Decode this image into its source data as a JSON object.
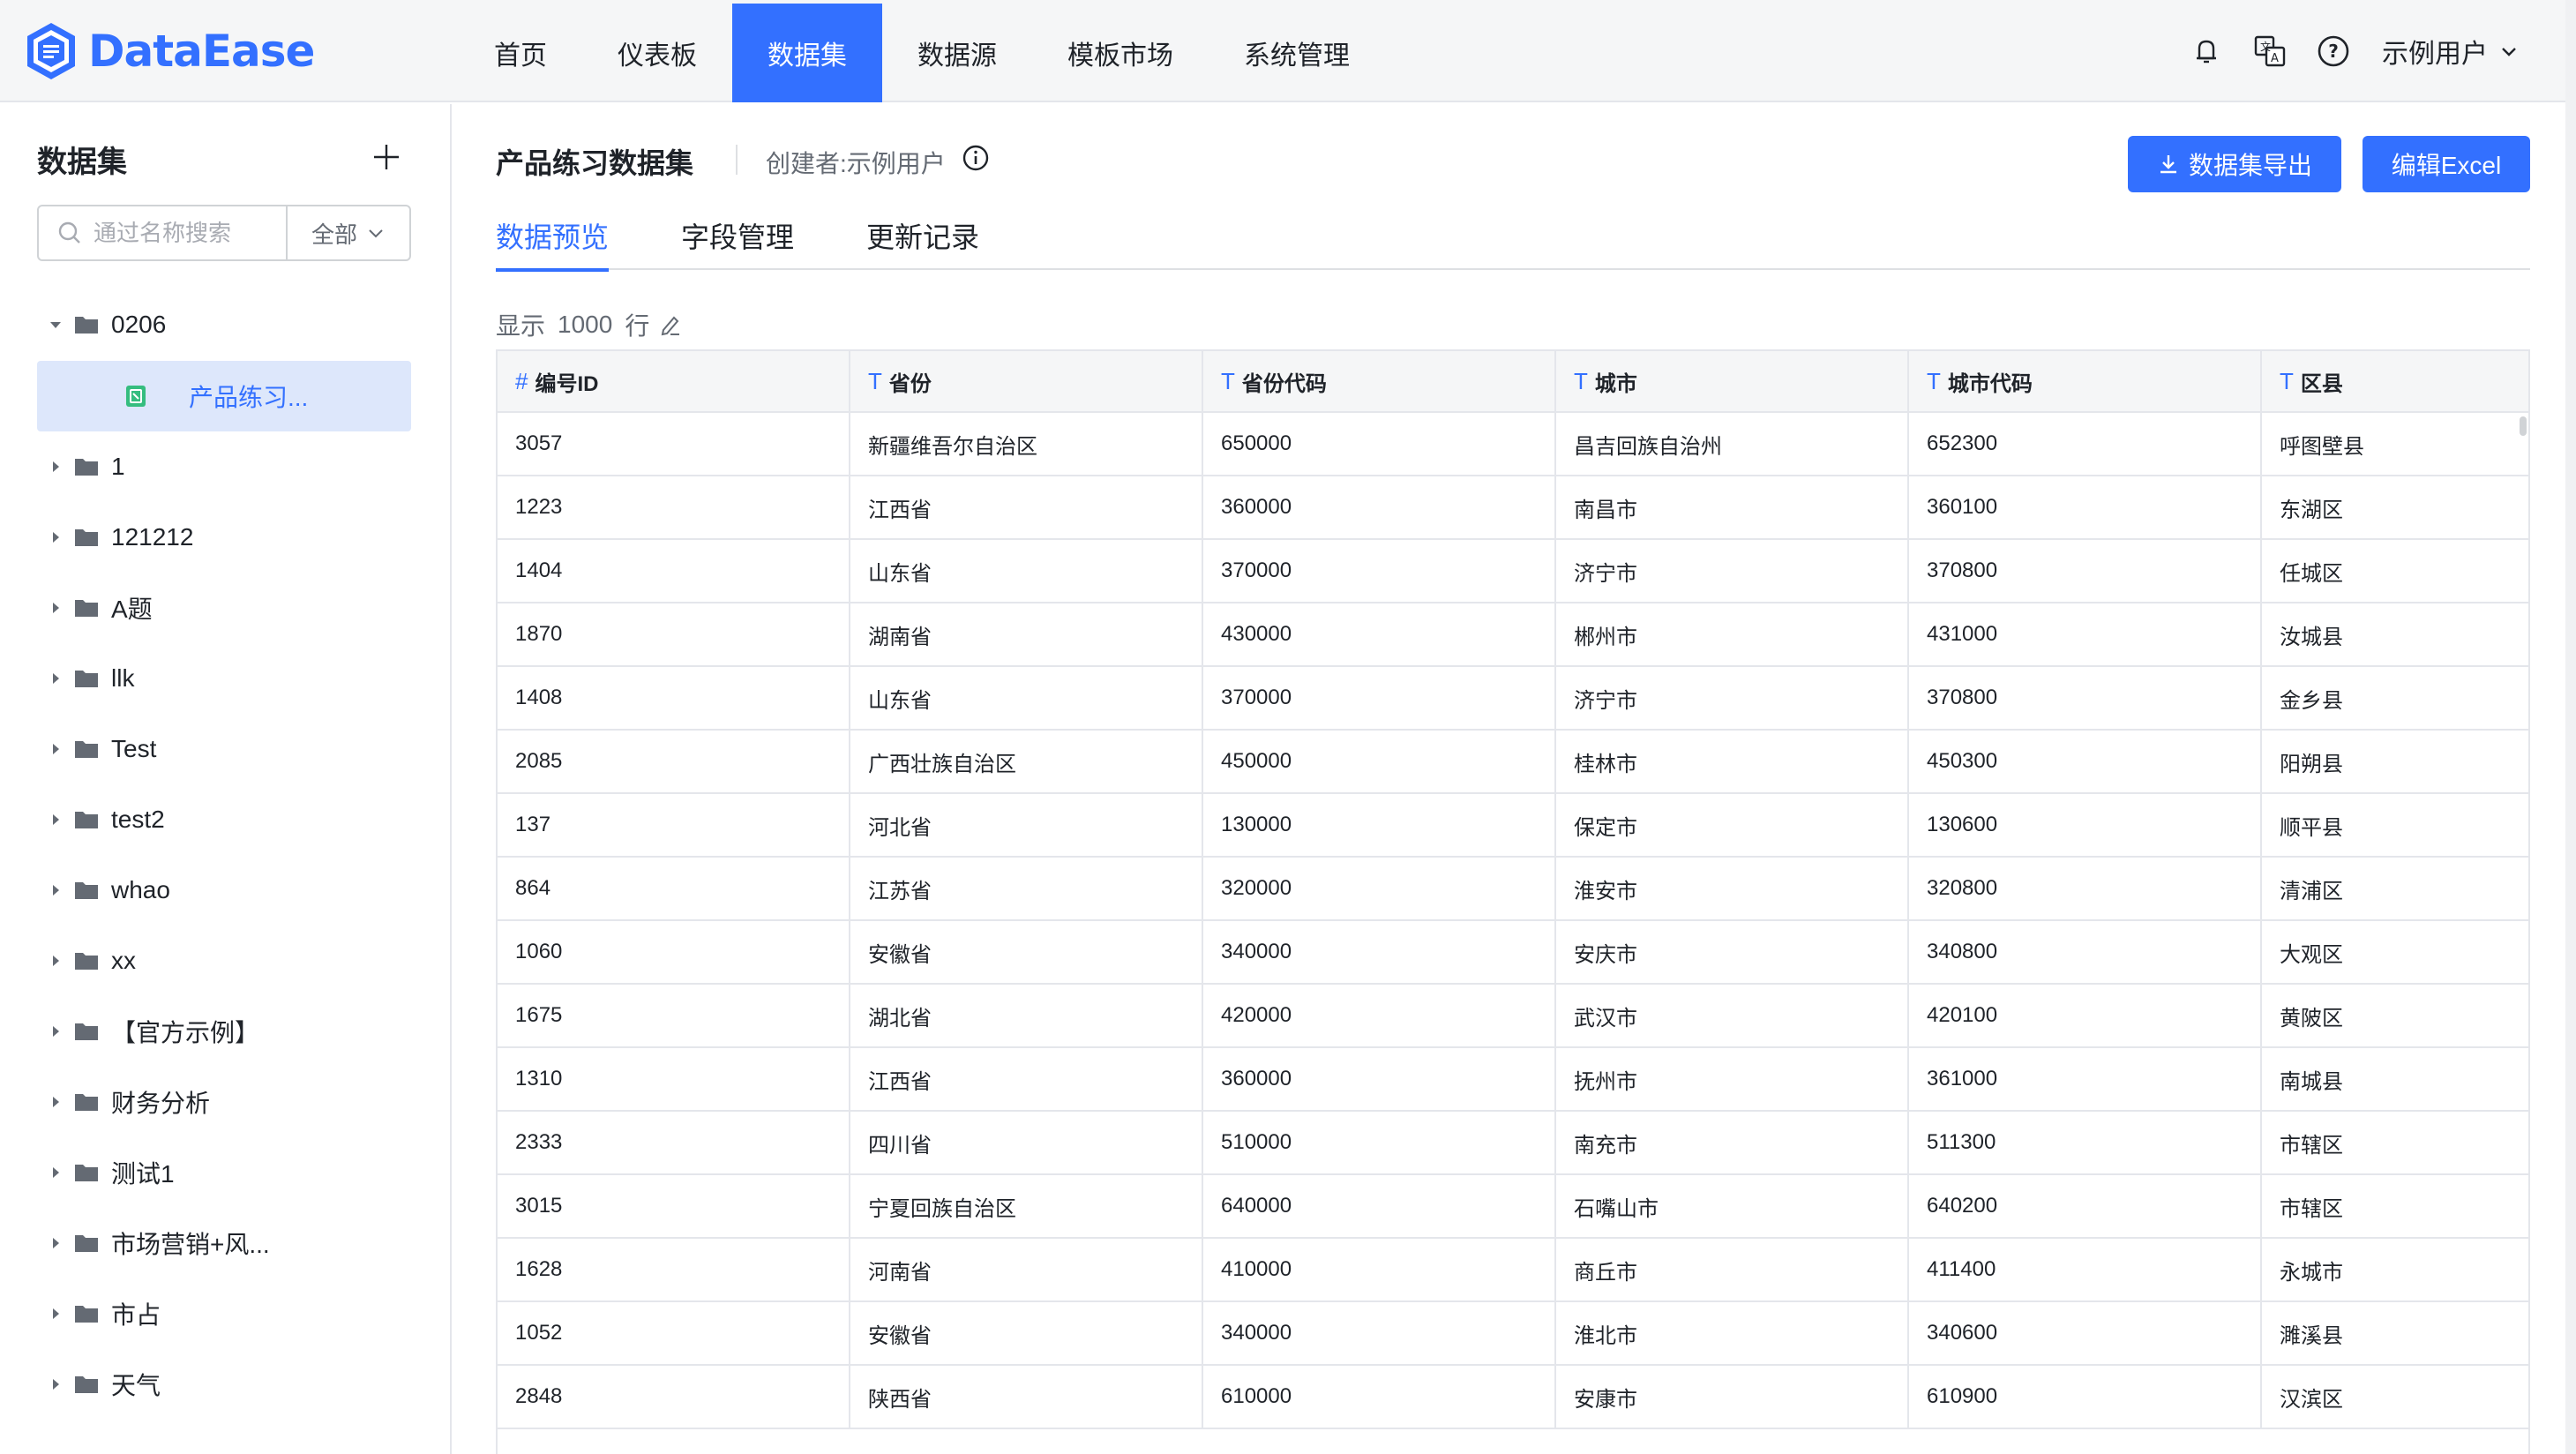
{
  "app": {
    "name": "DataEase",
    "brand_color": "#3370ff"
  },
  "nav": {
    "items": [
      "首页",
      "仪表板",
      "数据集",
      "数据源",
      "模板市场",
      "系统管理"
    ],
    "active_index": 2
  },
  "top_right": {
    "icons": [
      "notification-bell-icon",
      "translate-icon",
      "help-icon"
    ],
    "user_name": "示例用户"
  },
  "sidebar": {
    "title": "数据集",
    "search_placeholder": "通过名称搜索",
    "filter_label": "全部",
    "tree": [
      {
        "label": "0206",
        "expanded": true
      },
      {
        "label": "产品练习...",
        "selected": true,
        "is_dataset": true
      },
      {
        "label": "1"
      },
      {
        "label": "121212"
      },
      {
        "label": "A题"
      },
      {
        "label": "llk"
      },
      {
        "label": "Test"
      },
      {
        "label": "test2"
      },
      {
        "label": "whao"
      },
      {
        "label": "xx"
      },
      {
        "label": "【官方示例】"
      },
      {
        "label": "财务分析"
      },
      {
        "label": "测试1"
      },
      {
        "label": "市场营销+风..."
      },
      {
        "label": "市占"
      },
      {
        "label": "天气"
      }
    ]
  },
  "main": {
    "title": "产品练习数据集",
    "creator": "创建者:示例用户",
    "export_button": "数据集导出",
    "edit_button": "编辑Excel",
    "tabs": [
      "数据预览",
      "字段管理",
      "更新记录"
    ],
    "active_tab": 0,
    "rows_prefix": "显示",
    "rows_count": "1000",
    "rows_suffix": "行",
    "table": {
      "columns": [
        {
          "type": "#",
          "name": "编号ID"
        },
        {
          "type": "T",
          "name": "省份"
        },
        {
          "type": "T",
          "name": "省份代码"
        },
        {
          "type": "T",
          "name": "城市"
        },
        {
          "type": "T",
          "name": "城市代码"
        },
        {
          "type": "T",
          "name": "区县"
        }
      ],
      "rows": [
        [
          "3057",
          "新疆维吾尔自治区",
          "650000",
          "昌吉回族自治州",
          "652300",
          "呼图壁县"
        ],
        [
          "1223",
          "江西省",
          "360000",
          "南昌市",
          "360100",
          "东湖区"
        ],
        [
          "1404",
          "山东省",
          "370000",
          "济宁市",
          "370800",
          "任城区"
        ],
        [
          "1870",
          "湖南省",
          "430000",
          "郴州市",
          "431000",
          "汝城县"
        ],
        [
          "1408",
          "山东省",
          "370000",
          "济宁市",
          "370800",
          "金乡县"
        ],
        [
          "2085",
          "广西壮族自治区",
          "450000",
          "桂林市",
          "450300",
          "阳朔县"
        ],
        [
          "137",
          "河北省",
          "130000",
          "保定市",
          "130600",
          "顺平县"
        ],
        [
          "864",
          "江苏省",
          "320000",
          "淮安市",
          "320800",
          "清浦区"
        ],
        [
          "1060",
          "安徽省",
          "340000",
          "安庆市",
          "340800",
          "大观区"
        ],
        [
          "1675",
          "湖北省",
          "420000",
          "武汉市",
          "420100",
          "黄陂区"
        ],
        [
          "1310",
          "江西省",
          "360000",
          "抚州市",
          "361000",
          "南城县"
        ],
        [
          "2333",
          "四川省",
          "510000",
          "南充市",
          "511300",
          "市辖区"
        ],
        [
          "3015",
          "宁夏回族自治区",
          "640000",
          "石嘴山市",
          "640200",
          "市辖区"
        ],
        [
          "1628",
          "河南省",
          "410000",
          "商丘市",
          "411400",
          "永城市"
        ],
        [
          "1052",
          "安徽省",
          "340000",
          "淮北市",
          "340600",
          "濉溪县"
        ],
        [
          "2848",
          "陕西省",
          "610000",
          "安康市",
          "610900",
          "汉滨区"
        ]
      ]
    }
  }
}
